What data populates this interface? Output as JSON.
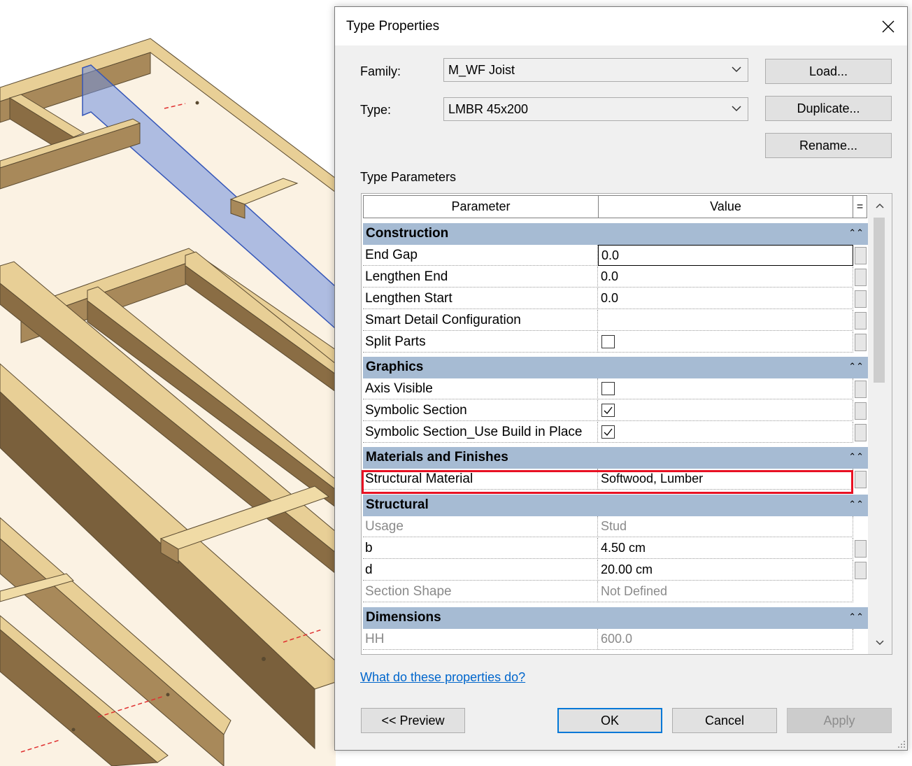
{
  "dialog": {
    "title": "Type Properties",
    "family_label": "Family:",
    "family_value": "M_WF Joist",
    "type_label": "Type:",
    "type_value": "LMBR 45x200",
    "load_button": "Load...",
    "duplicate_button": "Duplicate...",
    "rename_button": "Rename...",
    "section_label": "Type Parameters",
    "columns": {
      "parameter": "Parameter",
      "value": "Value",
      "eq": "="
    },
    "groups": {
      "construction": {
        "title": "Construction",
        "rows": [
          {
            "param": "End Gap",
            "value": "0.0"
          },
          {
            "param": "Lengthen End",
            "value": "0.0"
          },
          {
            "param": "Lengthen Start",
            "value": "0.0"
          },
          {
            "param": "Smart Detail Configuration",
            "value": ""
          },
          {
            "param": "Split Parts",
            "checked": false
          }
        ]
      },
      "graphics": {
        "title": "Graphics",
        "rows": [
          {
            "param": "Axis Visible",
            "checked": false
          },
          {
            "param": "Symbolic Section",
            "checked": true
          },
          {
            "param": "Symbolic Section_Use Build in Place",
            "checked": true
          }
        ]
      },
      "materials": {
        "title": "Materials and Finishes",
        "rows": [
          {
            "param": "Structural Material",
            "value": "Softwood, Lumber"
          }
        ]
      },
      "structural": {
        "title": "Structural",
        "rows": [
          {
            "param": "Usage",
            "value": "Stud"
          },
          {
            "param": "b",
            "value": "4.50 cm"
          },
          {
            "param": "d",
            "value": "20.00 cm"
          },
          {
            "param": "Section Shape",
            "value": "Not Defined"
          }
        ]
      },
      "dimensions": {
        "title": "Dimensions",
        "rows": [
          {
            "param": "HH",
            "value": "600.0"
          }
        ]
      }
    },
    "help_link": "What do these properties do?",
    "preview_button": "<< Preview",
    "ok_button": "OK",
    "cancel_button": "Cancel",
    "apply_button": "Apply"
  },
  "colors": {
    "group_header": "#a6bbd3",
    "highlight": "#e81123",
    "link": "#0066cc",
    "ok_border": "#0078d7",
    "wood_face": "#e8cf96",
    "wood_side": "#a8895a",
    "wood_dark": "#6e5738",
    "selected_joist": "#6f8fe0"
  }
}
